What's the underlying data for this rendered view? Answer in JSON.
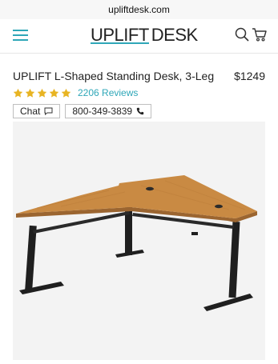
{
  "browser": {
    "url": "upliftdesk.com"
  },
  "header": {
    "logo_word1": "UPLIFT",
    "logo_word2": "DESK",
    "menu_icon": "hamburger-menu-icon",
    "search_icon": "search-icon",
    "cart_icon": "cart-icon"
  },
  "product": {
    "title": "UPLIFT L-Shaped Standing Desk, 3-Leg",
    "price": "$1249",
    "rating": 5,
    "reviews_label": "2206 Reviews",
    "chat_label": "Chat",
    "phone_label": "800-349-3839"
  },
  "colors": {
    "accent": "#2fa7b8",
    "star": "#e8b423",
    "desktop_wood": "#c98a43",
    "frame": "#1f1f1f",
    "image_bg": "#f3f3f3"
  }
}
